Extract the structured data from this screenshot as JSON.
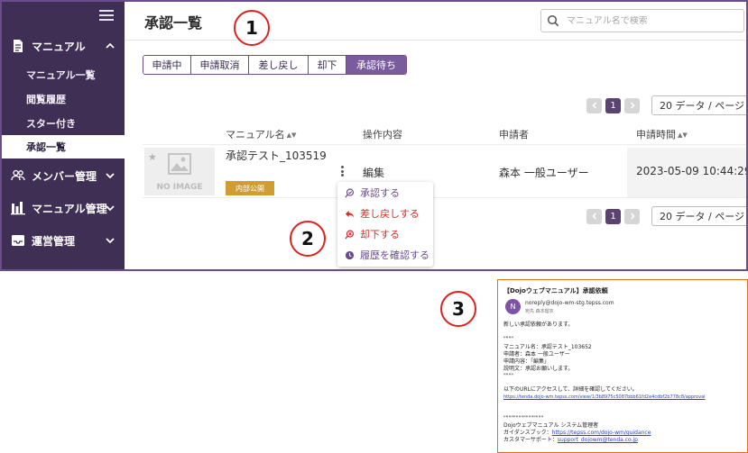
{
  "sidebar": {
    "sections": [
      {
        "label": "マニュアル",
        "icon": "document-icon",
        "chevron": "up"
      },
      {
        "label": "メンバー管理",
        "icon": "users-icon",
        "chevron": "down"
      },
      {
        "label": "マニュアル管理",
        "icon": "bar-chart-icon",
        "chevron": "down"
      },
      {
        "label": "運営管理",
        "icon": "inbox-icon",
        "chevron": "down"
      }
    ],
    "sub_items": [
      {
        "label": "マニュアル一覧"
      },
      {
        "label": "閲覧履歴"
      },
      {
        "label": "スター付き"
      },
      {
        "label": "承認一覧",
        "active": true
      }
    ]
  },
  "header": {
    "title": "承認一覧",
    "search_placeholder": "マニュアル名で検索"
  },
  "tabs": [
    {
      "label": "申請中"
    },
    {
      "label": "申請取消"
    },
    {
      "label": "差し戻し"
    },
    {
      "label": "却下"
    },
    {
      "label": "承認待ち",
      "active": true
    }
  ],
  "pagination": {
    "page": "1",
    "per_page": "20 データ / ページ"
  },
  "table": {
    "headers": {
      "name": "マニュアル名",
      "operation": "操作内容",
      "applicant": "申請者",
      "time": "申請時間"
    },
    "row": {
      "no_image": "NO IMAGE",
      "name": "承認テスト_103519",
      "badge": "内部公開",
      "operation": "編集",
      "applicant": "森本 一般ユーザー",
      "time": "2023-05-09 10:44:29"
    }
  },
  "context_menu": [
    {
      "label": "承認する",
      "icon": "approve-icon",
      "color": "#6a4c8c"
    },
    {
      "label": "差し戻しする",
      "icon": "reply-icon",
      "color": "#d0302a"
    },
    {
      "label": "却下する",
      "icon": "reject-icon",
      "color": "#d0302a"
    },
    {
      "label": "履歴を確認する",
      "icon": "history-icon",
      "color": "#6a4c8c"
    }
  ],
  "callouts": [
    "1",
    "2",
    "3"
  ],
  "email": {
    "subject": "【Dojoウェブマニュアル】承認依頼",
    "avatar": "N",
    "from": "noreply@dojo-wm-stg.tepss.com",
    "to": "宛先  森本瑠衣",
    "lines": [
      "新しい承認依頼があります。",
      "\"\"\"\"",
      "マニュアル名：承認テスト_103652",
      "申請者：森本 一般ユーザー",
      "申請内容：「編集」",
      "説明文：承認お願いします。",
      "\"\"\"\"",
      "以下のURLにアクセスして、詳細を確認してください。",
      "https://tenda.dojo-wm.tepss.com/view/1/3b8975c5087bbb61fd2e4cdbf2b778c8/approval",
      "\"\"\"\"\"\"\"\"\"\"\"\"\"\"\"\"",
      "Dojoウェブマニュアル システム管理者",
      "ガイダンスブック：",
      "https://tepss.com/dojo-wm/guidance",
      "カスタマーサポート：",
      "support_dojowm@tenda.co.jp"
    ]
  },
  "colors": {
    "sidebar": "#3f2f55",
    "accent": "#7a5c9e",
    "badge": "#cf9d32",
    "callout": "#e02020"
  }
}
